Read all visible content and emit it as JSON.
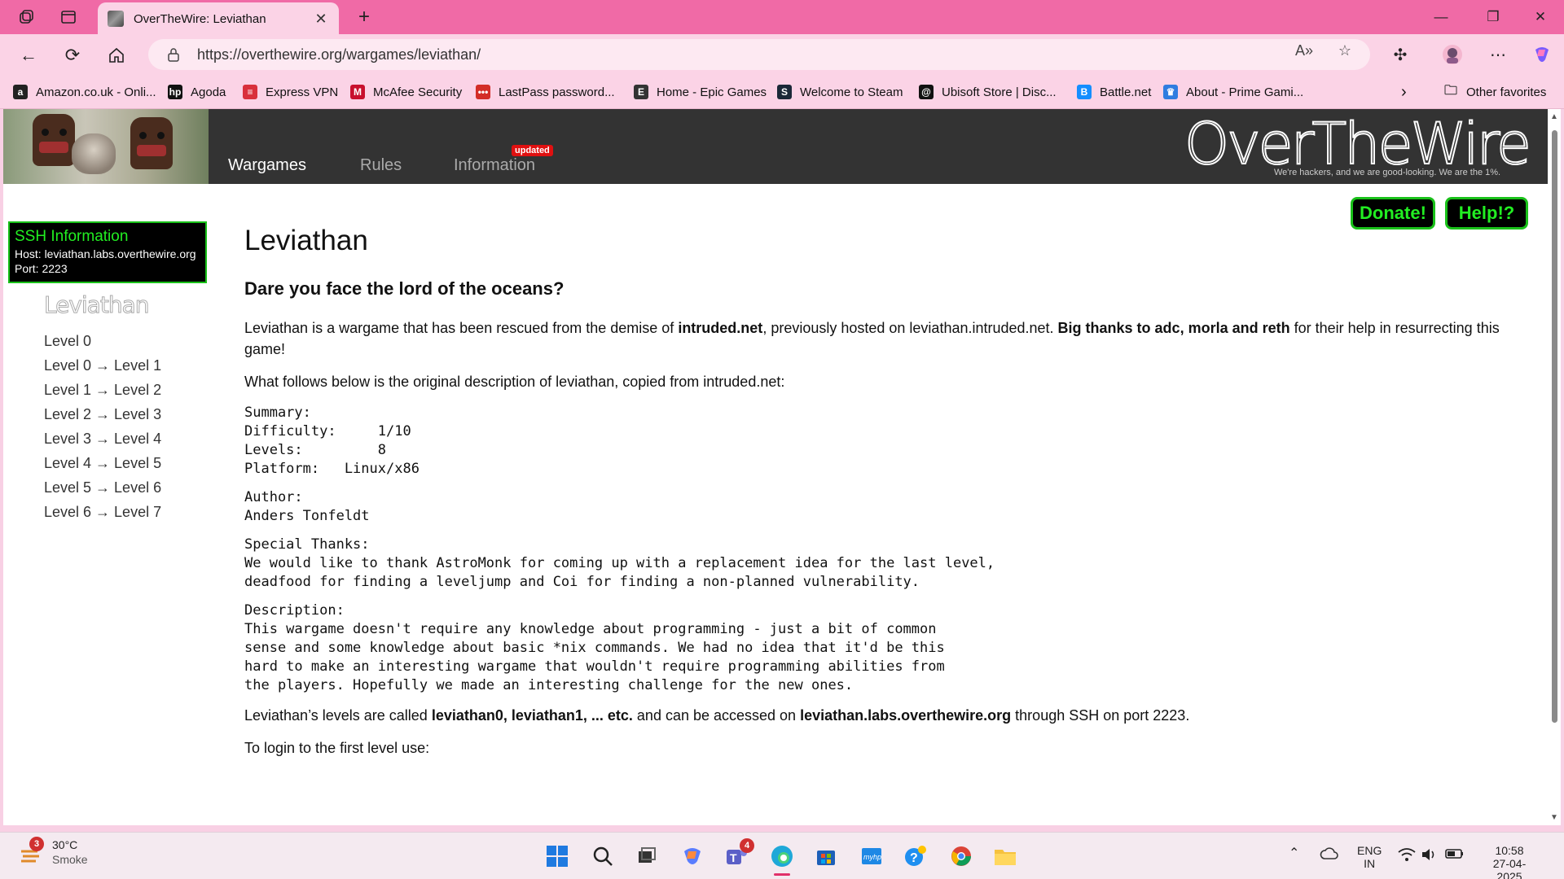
{
  "browser": {
    "tab_title": "OverTheWire: Leviathan",
    "url": "https://overthewire.org/wargames/leviathan/",
    "favorites": [
      {
        "label": "Amazon.co.uk - Onli...",
        "icon": "amazon-icon",
        "color": "#222222",
        "glyph": "a"
      },
      {
        "label": "Agoda",
        "icon": "hp-icon",
        "color": "#111111",
        "glyph": "hp"
      },
      {
        "label": "Express VPN",
        "icon": "expressvpn-icon",
        "color": "#d9303c",
        "glyph": "≡"
      },
      {
        "label": "McAfee Security",
        "icon": "mcafee-icon",
        "color": "#c8102e",
        "glyph": "M"
      },
      {
        "label": "LastPass password...",
        "icon": "lastpass-icon",
        "color": "#d32d27",
        "glyph": "•••"
      },
      {
        "label": "Home - Epic Games",
        "icon": "epic-games-icon",
        "color": "#333333",
        "glyph": "E"
      },
      {
        "label": "Welcome to Steam",
        "icon": "steam-icon",
        "color": "#1b2838",
        "glyph": "S"
      },
      {
        "label": "Ubisoft Store | Disc...",
        "icon": "ubisoft-icon",
        "color": "#111111",
        "glyph": "@"
      },
      {
        "label": "Battle.net",
        "icon": "battlenet-icon",
        "color": "#148eff",
        "glyph": "B"
      },
      {
        "label": "About - Prime Gami...",
        "icon": "prime-gaming-icon",
        "color": "#2f7de0",
        "glyph": "♛"
      }
    ],
    "other_favorites": "Other favorites"
  },
  "site": {
    "menu": [
      "Wargames",
      "Rules",
      "Information"
    ],
    "updated_badge": "updated",
    "logo": "OverTheWire",
    "slogan": "We're hackers, and we are good-looking. We are the 1%.",
    "donate": "Donate!",
    "help": "Help!?"
  },
  "sidebar": {
    "ssh_title": "SSH Information",
    "host": "Host: leviathan.labs.overthewire.org",
    "port": "Port: 2223",
    "logo": "Leviathan",
    "levels": [
      "Level 0",
      "Level 0 → Level 1",
      "Level 1 → Level 2",
      "Level 2 → Level 3",
      "Level 3 → Level 4",
      "Level 4 → Level 5",
      "Level 5 → Level 6",
      "Level 6 → Level 7"
    ]
  },
  "content": {
    "title": "Leviathan",
    "subtitle": "Dare you face the lord of the oceans?",
    "p1_a": "Leviathan is a wargame that has been rescued from the demise of ",
    "p1_b": "intruded.net",
    "p1_c": ", previously hosted on leviathan.intruded.net. ",
    "p1_d": "Big thanks to adc, morla and reth",
    "p1_e": " for their help in resurrecting this game!",
    "p2": "What follows below is the original description of leviathan, copied from intruded.net:",
    "pre1": "Summary:\nDifficulty:     1/10\nLevels:         8\nPlatform:   Linux/x86",
    "pre2": "Author:\nAnders Tonfeldt",
    "pre3": "Special Thanks:\nWe would like to thank AstroMonk for coming up with a replacement idea for the last level,\ndeadfood for finding a leveljump and Coi for finding a non-planned vulnerability.",
    "pre4": "Description:\nThis wargame doesn't require any knowledge about programming - just a bit of common\nsense and some knowledge about basic *nix commands. We had no idea that it'd be this\nhard to make an interesting wargame that wouldn't require programming abilities from\nthe players. Hopefully we made an interesting challenge for the new ones.",
    "p3_a": "Leviathan’s levels are called ",
    "p3_b": "leviathan0, leviathan1, ... etc.",
    "p3_c": " and can be accessed on ",
    "p3_d": "leviathan.labs.overthewire.org",
    "p3_e": " through SSH on port 2223.",
    "p4": "To login to the first level use:"
  },
  "taskbar": {
    "weather_temp": "30°C",
    "weather_desc": "Smoke",
    "weather_badge": "3",
    "teams_badge": "4",
    "lang1": "ENG",
    "lang2": "IN",
    "time": "10:58",
    "date": "27-04-2025"
  }
}
